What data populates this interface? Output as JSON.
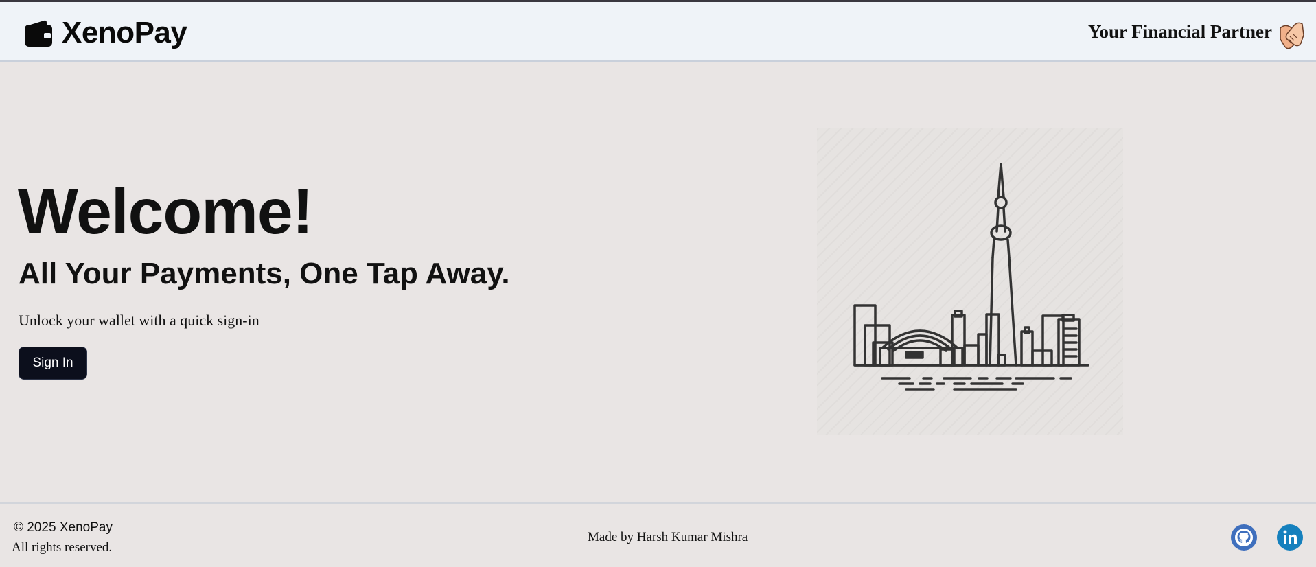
{
  "header": {
    "brand_name": "XenoPay",
    "brand_icon": "wallet-icon",
    "tagline": "Your Financial Partner",
    "tagline_icon": "handshake-icon"
  },
  "hero": {
    "title": "Welcome!",
    "subtitle": "All Your Payments, One Tap Away.",
    "description": "Unlock your wallet with a quick sign-in",
    "signin_label": "Sign In",
    "illustration": "city-skyline-illustration"
  },
  "footer": {
    "copyright": "© 2025 XenoPay",
    "rights": "All rights reserved.",
    "made_by": "Made by Harsh Kumar Mishra",
    "social": [
      {
        "name": "github-icon"
      },
      {
        "name": "linkedin-icon"
      }
    ]
  },
  "colors": {
    "header_bg": "#eff3f8",
    "page_bg": "#e9e5e4",
    "button_bg": "#0c0f1c",
    "github": "#3f6fbd",
    "linkedin": "#1580bd"
  }
}
